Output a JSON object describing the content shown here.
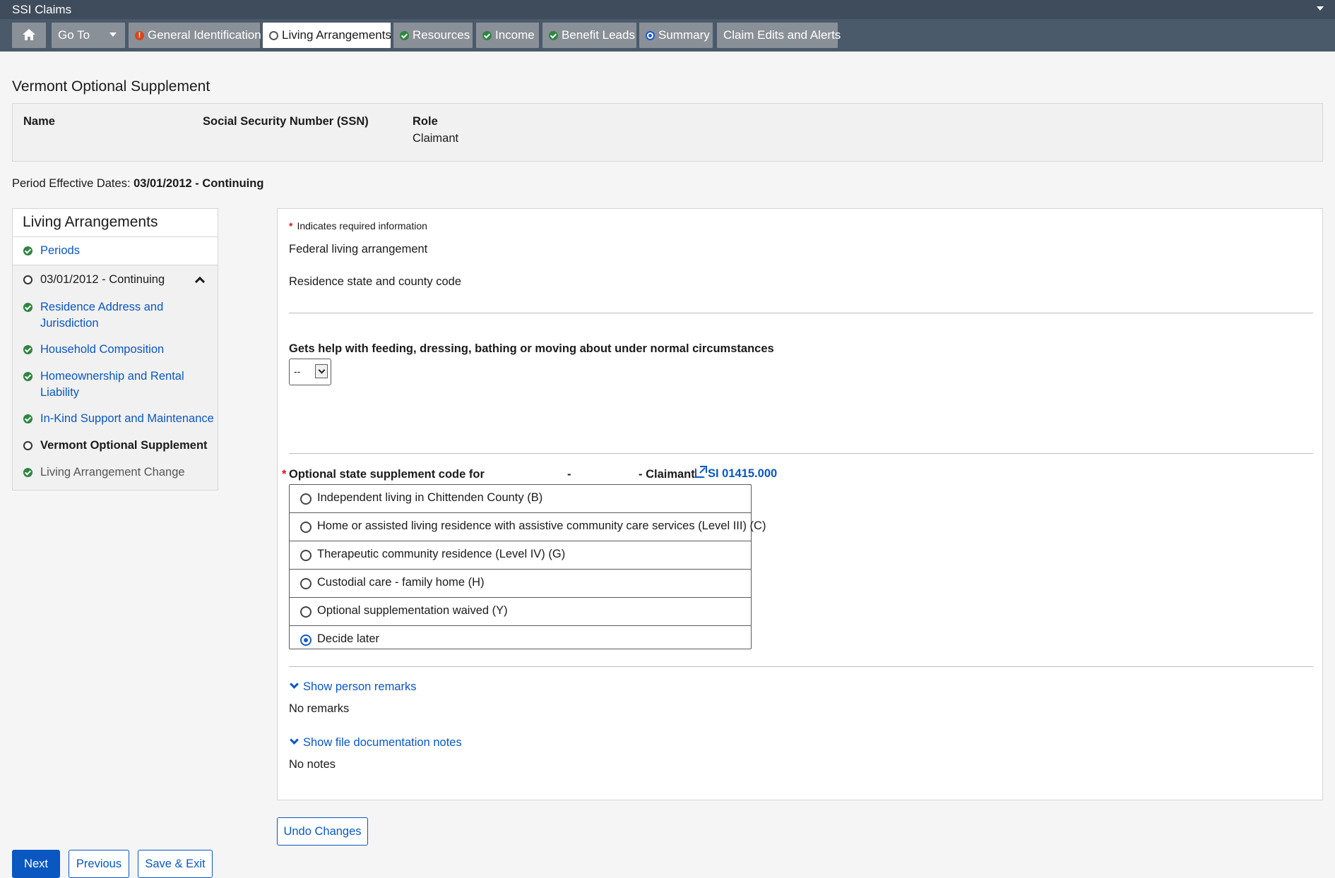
{
  "app": {
    "title": "SSI Claims",
    "menu_icon": "caret-down-icon"
  },
  "nav": {
    "goto_label": "Go To",
    "tabs": [
      {
        "label": "General Identification",
        "status": "warning"
      },
      {
        "label": "Living Arrangements",
        "status": "in-progress",
        "active": true
      },
      {
        "label": "Resources",
        "status": "complete"
      },
      {
        "label": "Income",
        "status": "complete"
      },
      {
        "label": "Benefit Leads",
        "status": "complete"
      },
      {
        "label": "Summary",
        "status": "current"
      },
      {
        "label": "Claim Edits and Alerts",
        "status": "none"
      }
    ]
  },
  "page": {
    "title": "Vermont Optional Supplement",
    "id_labels": {
      "name": "Name",
      "ssn": "Social Security Number (SSN)",
      "role": "Role"
    },
    "id_values": {
      "role": "Claimant"
    },
    "period_label": "Period Effective Dates:",
    "period_value": "03/01/2012 - Continuing"
  },
  "sidebar": {
    "title": "Living Arrangements",
    "items": [
      {
        "label": "Periods",
        "status": "complete"
      },
      {
        "label": "03/01/2012 - Continuing",
        "status": "in-progress"
      },
      {
        "label": "Residence Address and Jurisdiction",
        "status": "complete"
      },
      {
        "label": "Household Composition",
        "status": "complete"
      },
      {
        "label": "Homeownership and Rental Liability",
        "status": "complete"
      },
      {
        "label": "In-Kind Support and Maintenance",
        "status": "complete"
      },
      {
        "label": "Vermont Optional Supplement",
        "status": "in-progress",
        "current": true
      },
      {
        "label": "Living Arrangement Change",
        "status": "complete"
      }
    ]
  },
  "form": {
    "required_note": "Indicates required information",
    "federal_la": "Federal living arrangement",
    "residence_code": "Residence state and county code",
    "help_question": "Gets help with feeding, dressing, bathing or moving about under normal circumstances",
    "help_value": "--",
    "oss_label_prefix": "Optional state supplement code for",
    "oss_label_dash": "-",
    "oss_label_suffix": "- Claimant",
    "oss_link": "SI 01415.000",
    "options": [
      {
        "label": "Independent living in Chittenden County (B)",
        "checked": false
      },
      {
        "label": "Home or assisted living residence with assistive community care services (Level III) (C)",
        "checked": false
      },
      {
        "label": "Therapeutic community residence (Level IV) (G)",
        "checked": false
      },
      {
        "label": "Custodial care - family home (H)",
        "checked": false
      },
      {
        "label": "Optional supplementation waived (Y)",
        "checked": false
      },
      {
        "label": "Decide later",
        "checked": true
      }
    ],
    "show_remarks": "Show person remarks",
    "no_remarks": "No remarks",
    "show_notes": "Show file documentation notes",
    "no_notes": "No notes"
  },
  "buttons": {
    "undo": "Undo Changes",
    "next": "Next",
    "previous": "Previous",
    "save_exit": "Save & Exit"
  },
  "colors": {
    "link": "#0a57c2",
    "complete": "#2e8540",
    "warning": "#d5461a",
    "header": "#3f4c5c"
  }
}
